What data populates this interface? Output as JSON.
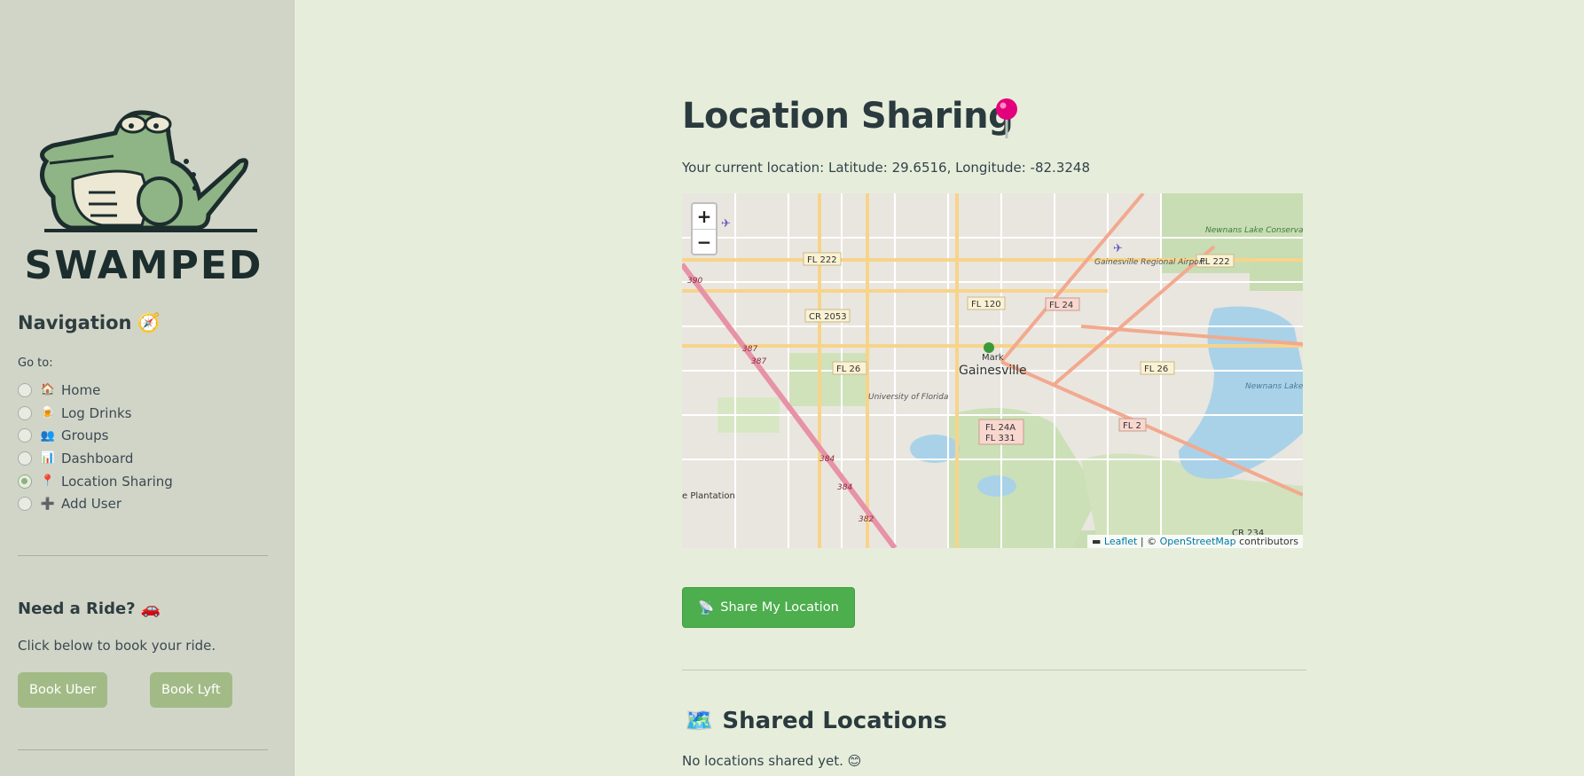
{
  "sidebar": {
    "brand": "SWAMPED",
    "nav_title": "Navigation",
    "nav_title_icon": "🧭",
    "goto_label": "Go to:",
    "items": [
      {
        "label": "Home",
        "icon": "🏠",
        "checked": false
      },
      {
        "label": "Log Drinks",
        "icon": "🍺",
        "checked": false
      },
      {
        "label": "Groups",
        "icon": "👥",
        "checked": false
      },
      {
        "label": "Dashboard",
        "icon": "📊",
        "checked": false
      },
      {
        "label": "Location Sharing",
        "icon": "📍",
        "checked": true
      },
      {
        "label": "Add User",
        "icon": "➕",
        "checked": false
      }
    ],
    "ride_title": "Need a Ride?",
    "ride_icon": "🚗",
    "ride_text": "Click below to book your ride.",
    "uber_label": "Book Uber",
    "lyft_label": "Book Lyft"
  },
  "main": {
    "title": "Location Sharing",
    "current_location": "Your current location: Latitude: 29.6516, Longitude: -82.3248",
    "map": {
      "zoom_in": "+",
      "zoom_out": "−",
      "attribution_leaflet": "Leaflet",
      "attribution_sep": " | © ",
      "attribution_osm": "OpenStreetMap",
      "attribution_tail": " contributors",
      "labels": {
        "city": "Gainesville",
        "mark": "Mark",
        "uf": "University of Florida",
        "airport": "Gainesville Regional Airport",
        "lake": "Newnans Lake",
        "conservation": "Newnans Lake Conservation Area",
        "plantation": "e Plantation",
        "fl222a": "FL 222",
        "fl222b": "FL 222",
        "fl120": "FL 120",
        "fl24": "FL 24",
        "cr2053": "CR 2053",
        "fl26a": "FL 26",
        "fl26b": "FL 26",
        "fl24a": "FL 24A",
        "fl331": "FL 331",
        "fl2": "FL 2",
        "cr234": "CR 234",
        "r390": "390",
        "r387a": "387",
        "r387b": "387",
        "r384a": "384",
        "r384b": "384",
        "r382": "382"
      }
    },
    "share_button": "Share My Location",
    "share_icon": "📡",
    "shared_title": "Shared Locations",
    "shared_icon": "🗺️",
    "no_locations": "No locations shared yet. 😊"
  },
  "colors": {
    "accent_green": "#4cae4c",
    "ride_button": "#a2bb86",
    "sidebar_bg": "#d1d5c8",
    "main_bg": "#e6eedb",
    "pin": "#e4007c"
  }
}
